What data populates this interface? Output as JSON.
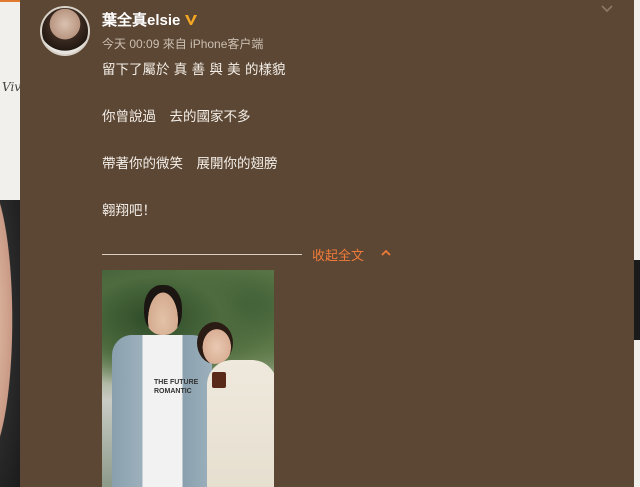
{
  "post": {
    "username": "葉全真elsie",
    "meta": "今天 00:09 來自 iPhone客户端",
    "lines": [
      "留下了屬於 真 善 與 美 的樣貌",
      "你曾說過　去的國家不多",
      "帶著你的微笑　展開你的翅膀",
      "翱翔吧！"
    ],
    "collapse_label": "收起全文",
    "photo_shirt_text": [
      "THE FUTURE",
      "ROMANTIC"
    ],
    "left_scribble": "Vive"
  },
  "icons": {
    "verified": "verified-badge-icon",
    "menu_chevron": "chevron-down-icon",
    "collapse_chevron": "chevron-up-icon"
  },
  "colors": {
    "background": "#5c4734",
    "accent": "#f07a3a",
    "verified": "#f5a623"
  }
}
